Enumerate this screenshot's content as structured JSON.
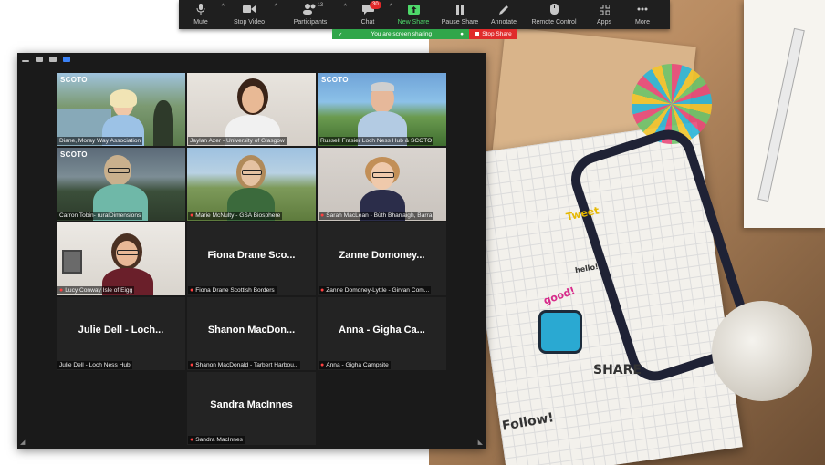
{
  "toolbar": {
    "items": [
      {
        "label": "Mute",
        "icon": "microphone-icon"
      },
      {
        "label": "Stop Video",
        "icon": "video-camera-icon"
      },
      {
        "label": "Participants",
        "icon": "participants-icon",
        "count": "13"
      },
      {
        "label": "Chat",
        "icon": "chat-icon",
        "badge": "30"
      },
      {
        "label": "New Share",
        "icon": "share-screen-icon"
      },
      {
        "label": "Pause Share",
        "icon": "pause-icon"
      },
      {
        "label": "Annotate",
        "icon": "pencil-icon"
      },
      {
        "label": "Remote Control",
        "icon": "mouse-icon"
      },
      {
        "label": "Apps",
        "icon": "apps-icon"
      },
      {
        "label": "More",
        "icon": "more-icon"
      }
    ]
  },
  "share_banner": {
    "text": "You are screen sharing",
    "stop_label": "Stop Share"
  },
  "gallery": {
    "tiles": [
      {
        "caption": "Diane, Moray Way Association",
        "muted": false,
        "center_name": "",
        "video": true
      },
      {
        "caption": "Jaylan Azer - University of Glasgow",
        "muted": false,
        "center_name": "",
        "video": true
      },
      {
        "caption": "Russell Frasier Loch Ness Hub & SCOTO",
        "muted": false,
        "center_name": "",
        "video": true,
        "active": true
      },
      {
        "caption": "Carron Tobin- ruralDimensions",
        "muted": false,
        "center_name": "",
        "video": true
      },
      {
        "caption": "Marie McNulty - GSA Biosphere",
        "muted": true,
        "center_name": "",
        "video": true
      },
      {
        "caption": "Sarah MacLean - Bùth Bharraigh, Barra",
        "muted": true,
        "center_name": "",
        "video": true
      },
      {
        "caption": "Lucy Conway Isle of Eigg",
        "muted": true,
        "center_name": "",
        "video": true
      },
      {
        "caption": "Fiona Drane Scottish Borders",
        "muted": true,
        "center_name": "Fiona Drane Sco...",
        "video": false
      },
      {
        "caption": "Zanne Domoney-Lyttle - Girvan Com...",
        "muted": true,
        "center_name": "Zanne Domoney...",
        "video": false
      },
      {
        "caption": "Julie Dell - Loch Ness Hub",
        "muted": false,
        "center_name": "Julie Dell - Loch...",
        "video": false
      },
      {
        "caption": "Shanon MacDonald - Tarbert Harbou...",
        "muted": true,
        "center_name": "Shanon MacDon...",
        "video": false
      },
      {
        "caption": "Anna - Gigha Campsite",
        "muted": true,
        "center_name": "Anna - Gigha Ca...",
        "video": false
      },
      {
        "caption": "Sandra MacInnes",
        "muted": true,
        "center_name": "Sandra MacInnes",
        "video": false
      }
    ],
    "logo_text": "SCOTO"
  },
  "desk": {
    "doodles": [
      "Tweet",
      "good!",
      "SHARE",
      "Follow!",
      "hello!"
    ]
  },
  "colors": {
    "toolbar_bg": "#1f1f1f",
    "share_green": "#30a64a",
    "stop_red": "#e02b2b",
    "active_speaker": "#d2e86b",
    "gallery_bg": "#1a1a1a"
  }
}
